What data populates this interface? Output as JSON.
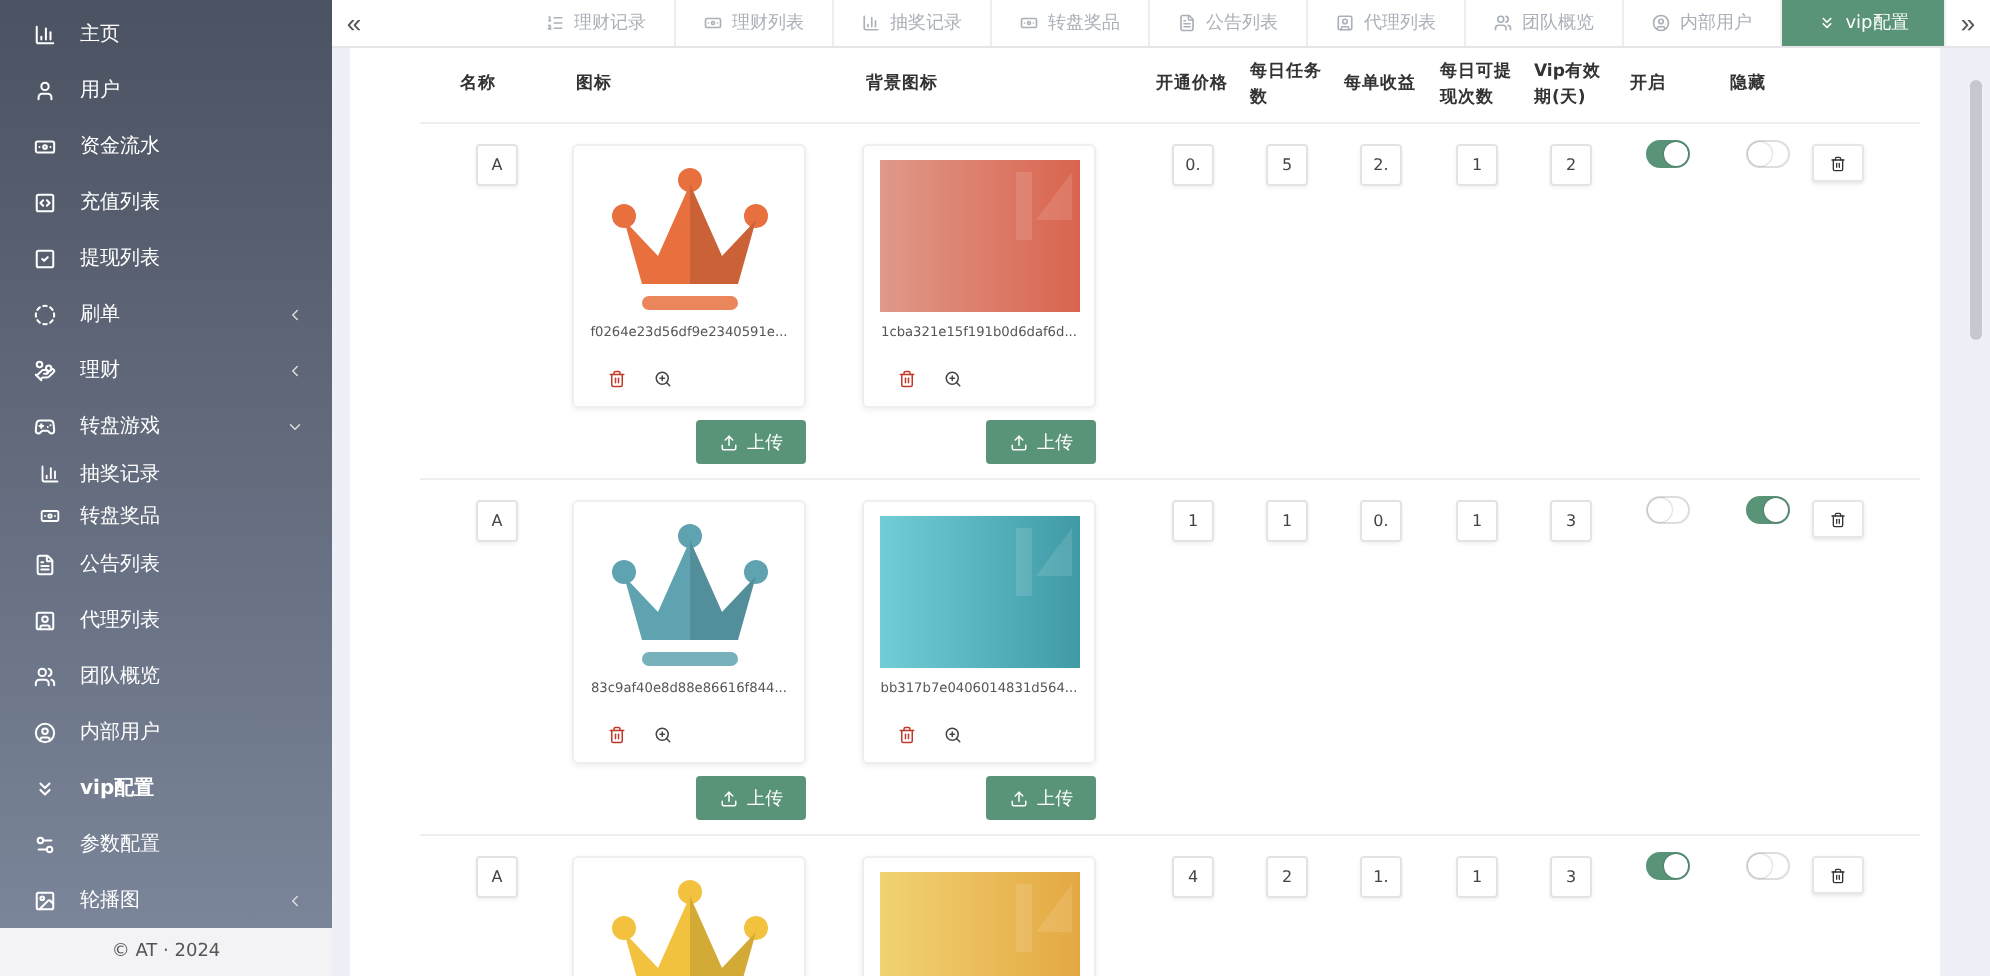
{
  "sidebar": {
    "items": [
      {
        "label": "主页",
        "selected": false
      },
      {
        "label": "用户",
        "selected": false
      },
      {
        "label": "资金流水",
        "selected": false
      },
      {
        "label": "充值列表",
        "selected": false
      },
      {
        "label": "提现列表",
        "selected": false
      },
      {
        "label": "刷单",
        "selected": false,
        "expanded": false
      },
      {
        "label": "理财",
        "selected": false,
        "expanded": false
      },
      {
        "label": "转盘游戏",
        "selected": false,
        "expanded": true,
        "children": [
          {
            "label": "抽奖记录",
            "selected": false
          },
          {
            "label": "转盘奖品",
            "selected": false
          }
        ]
      },
      {
        "label": "公告列表",
        "selected": false
      },
      {
        "label": "代理列表",
        "selected": false
      },
      {
        "label": "团队概览",
        "selected": false
      },
      {
        "label": "内部用户",
        "selected": false
      },
      {
        "label": "vip配置",
        "selected": true
      },
      {
        "label": "参数配置",
        "selected": false
      },
      {
        "label": "轮播图",
        "selected": false,
        "expanded": false
      }
    ],
    "footer": "© AT · 2024"
  },
  "tabbar": {
    "prev": "«",
    "next": "»",
    "tabs": [
      {
        "label": "理财记录",
        "selected": false
      },
      {
        "label": "理财列表",
        "selected": false
      },
      {
        "label": "抽奖记录",
        "selected": false
      },
      {
        "label": "转盘奖品",
        "selected": false
      },
      {
        "label": "公告列表",
        "selected": false
      },
      {
        "label": "代理列表",
        "selected": false
      },
      {
        "label": "团队概览",
        "selected": false
      },
      {
        "label": "内部用户",
        "selected": false
      },
      {
        "label": "vip配置",
        "selected": true
      }
    ]
  },
  "table": {
    "columns": [
      "名称",
      "图标",
      "背景图标",
      "开通价格",
      "每日任务数",
      "每单收益",
      "每日可提现次数",
      "Vip有效期(天)",
      "开启",
      "隐藏"
    ],
    "rows": [
      {
        "name": "A",
        "icon": {
          "color": "#e8703f",
          "filename": "f0264e23d56df9e2340591e...",
          "upload": "上传"
        },
        "background": {
          "filename": "1cba321e15f191b0d6daf6d...",
          "upload": "上传"
        },
        "price": "0.",
        "tasks": "5",
        "income": "2.",
        "withdrawals": "1",
        "days": "2",
        "enabled": true,
        "hidden": false
      },
      {
        "name": "A",
        "icon": {
          "color": "#5fa3b0",
          "filename": "83c9af40e8d88e86616f844...",
          "upload": "上传"
        },
        "background": {
          "filename": "bb317b7e0406014831d564...",
          "upload": "上传"
        },
        "price": "1",
        "tasks": "1",
        "income": "0.",
        "withdrawals": "1",
        "days": "3",
        "enabled": false,
        "hidden": true
      },
      {
        "name": "A",
        "icon": {
          "color": "#f2c23e"
        },
        "background": {},
        "price": "4",
        "tasks": "2",
        "income": "1.",
        "withdrawals": "1",
        "days": "3",
        "enabled": true,
        "hidden": false
      }
    ]
  }
}
